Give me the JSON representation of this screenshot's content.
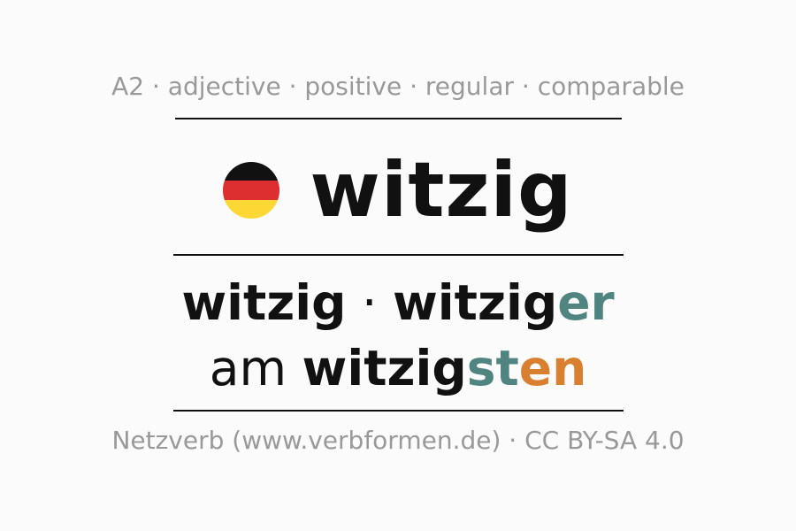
{
  "meta": {
    "level": "A2",
    "part_of_speech": "adjective",
    "degree": "positive",
    "inflection": "regular",
    "comparability": "comparable",
    "separator": " · "
  },
  "headword": {
    "text": "witzig",
    "language_flag": "germany-flag-icon"
  },
  "flag_colors": {
    "black": "#111111",
    "red": "#dd2f2f",
    "gold": "#fdd835"
  },
  "forms": {
    "positive": "witzig",
    "separator": " · ",
    "comparative_stem": "witzig",
    "comparative_ending": "er",
    "superlative_prefix": "am ",
    "superlative_stem": "witzig",
    "superlative_ending_1": "st",
    "superlative_ending_2": "en"
  },
  "colors": {
    "ending_teal": "#4f8480",
    "ending_orange": "#d98030",
    "meta_gray": "#999999",
    "text_dark": "#111111"
  },
  "footer": {
    "text": "Netzverb (www.verbformen.de) · CC BY-SA 4.0"
  }
}
